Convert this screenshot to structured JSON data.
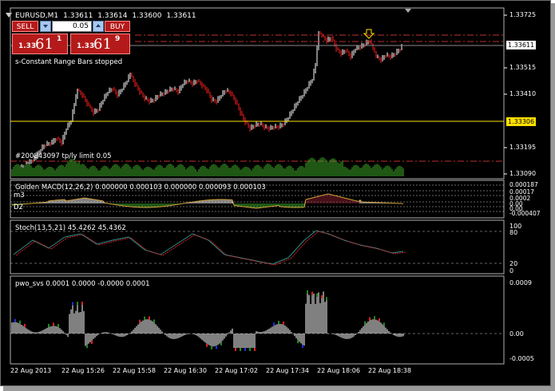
{
  "window": {
    "symbol": "EURUSD,M1",
    "quote_bid": "1.33611",
    "quote_high": "1.33614",
    "quote_low": "1.33600",
    "quote_close": "1.33611"
  },
  "trade_panel": {
    "sell_label": "SELL",
    "buy_label": "BUY",
    "volume": "0.05",
    "sell_small": "1.33",
    "sell_big": "61",
    "sell_sup": "1",
    "buy_small": "1.33",
    "buy_big": "61",
    "buy_sup": "9"
  },
  "status_text": "s-Constant Range Bars stopped",
  "order_label": "#200843097 tp/ly limit 0.05",
  "price_axis": {
    "ticks": [
      "1.33725",
      "1.33515",
      "1.33410",
      "1.33195",
      "1.33090"
    ],
    "highlight_bid": "1.33611",
    "highlight_line": "1.33306"
  },
  "macd": {
    "label": "Golden MACD(12,26,2) 0.000000 0.000103 0.000000 0.000093 0.000103",
    "m3": "m3",
    "d2": "D2",
    "ticks": [
      "0.000187",
      "0.00017",
      "0.0002",
      "0.00",
      "0.00",
      "-0.000407"
    ]
  },
  "stoch": {
    "label": "Stoch(13,5,21) 45.4262 45.4362",
    "ticks": [
      "100",
      "80",
      "20",
      "0"
    ]
  },
  "pwo": {
    "label": "pwo_svs 0.0001 0.0000 -0.0000 0.0001",
    "ticks": [
      "0.0009",
      "0.00",
      "-0.0005"
    ]
  },
  "time_axis": [
    "22 Aug 2013",
    "22 Aug 15:26",
    "22 Aug 15:58",
    "22 Aug 16:30",
    "22 Aug 17:02",
    "22 Aug 17:34",
    "22 Aug 18:06",
    "22 Aug 18:38"
  ],
  "colors": {
    "bull": "#ffffff",
    "bear": "#ff2020",
    "volume": "#3fae2a",
    "yellow_line": "#ffe000",
    "dash_red": "#c03030",
    "macd_fill": "#8a2030",
    "stoch_main": "#2f8c8c",
    "stoch_signal": "#d02020",
    "pwo_up": "#ffffff",
    "pwo_green": "#1a8a1a",
    "pwo_red": "#e02020",
    "pwo_blue": "#1a30e0"
  }
}
